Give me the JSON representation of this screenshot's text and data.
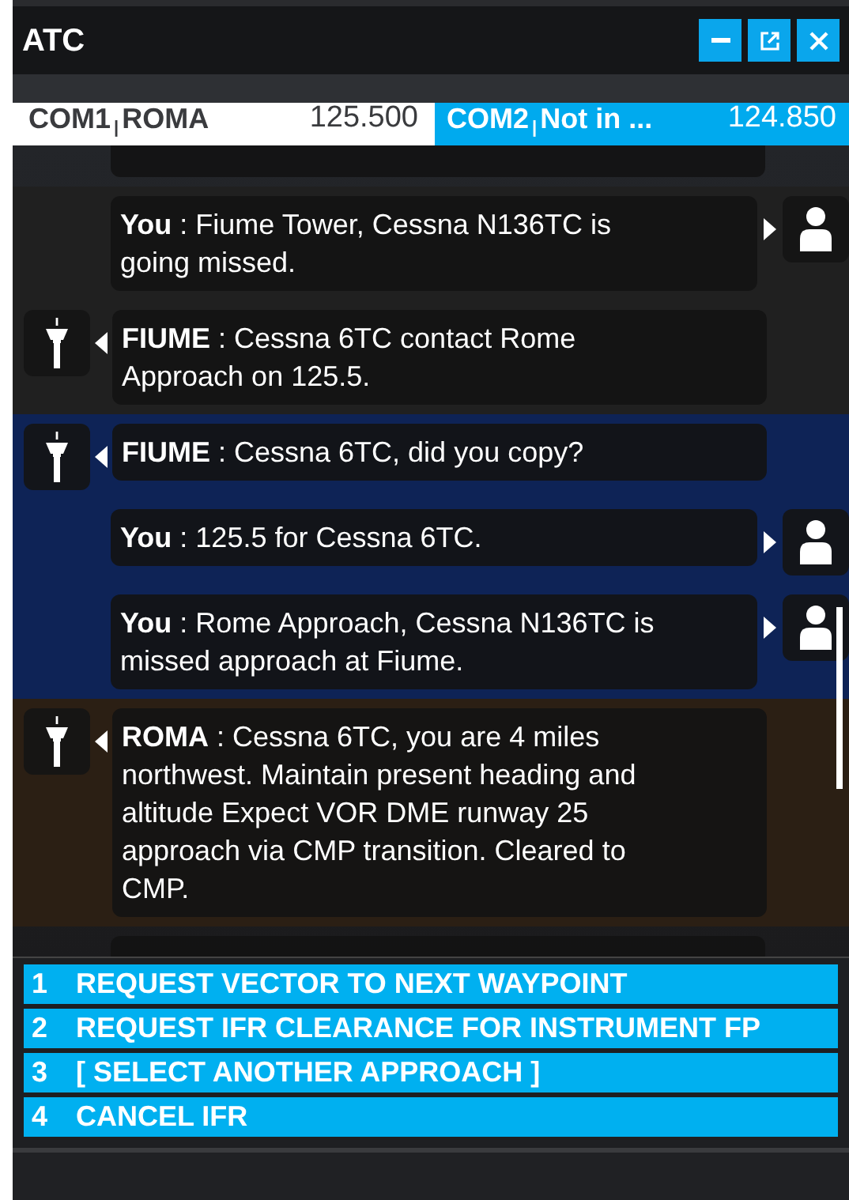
{
  "window": {
    "title": "ATC"
  },
  "tabs": [
    {
      "label": "COM1",
      "separator": "|",
      "station": "ROMA",
      "frequency": "125.500",
      "selected": true
    },
    {
      "label": "COM2",
      "separator": "|",
      "station": "Not in ...",
      "frequency": "124.850",
      "selected": false
    }
  ],
  "messages": [
    {
      "kind": "pilot",
      "speaker": "You",
      "text": " : Fiume Tower, Cessna N136TC is going missed.",
      "color": "#202020"
    },
    {
      "kind": "atc",
      "speaker": "FIUME",
      "text": " : Cessna 6TC contact Rome Approach on 125.5.",
      "color": "#202020"
    },
    {
      "kind": "atc",
      "speaker": "FIUME",
      "text": " : Cessna 6TC, did you copy?",
      "color": "#0e2356"
    },
    {
      "kind": "pilot",
      "speaker": "You",
      "text": " : 125.5 for Cessna 6TC.",
      "color": "#0e2356"
    },
    {
      "kind": "pilot",
      "speaker": "You",
      "text": " : Rome Approach, Cessna N136TC is missed approach at Fiume.",
      "color": "#0e2356"
    },
    {
      "kind": "atc",
      "speaker": "ROMA",
      "text": " : Cessna 6TC, you are 4 miles northwest. Maintain present heading and altitude Expect VOR DME runway 25 approach via CMP transition. Cleared to CMP.",
      "color": "#2b1f14"
    }
  ],
  "options": [
    {
      "number": "1",
      "label": "REQUEST VECTOR TO NEXT WAYPOINT"
    },
    {
      "number": "2",
      "label": "REQUEST IFR CLEARANCE FOR INSTRUMENT FP"
    },
    {
      "number": "3",
      "label": "[ SELECT ANOTHER APPROACH ]"
    },
    {
      "number": "4",
      "label": "CANCEL IFR"
    }
  ]
}
